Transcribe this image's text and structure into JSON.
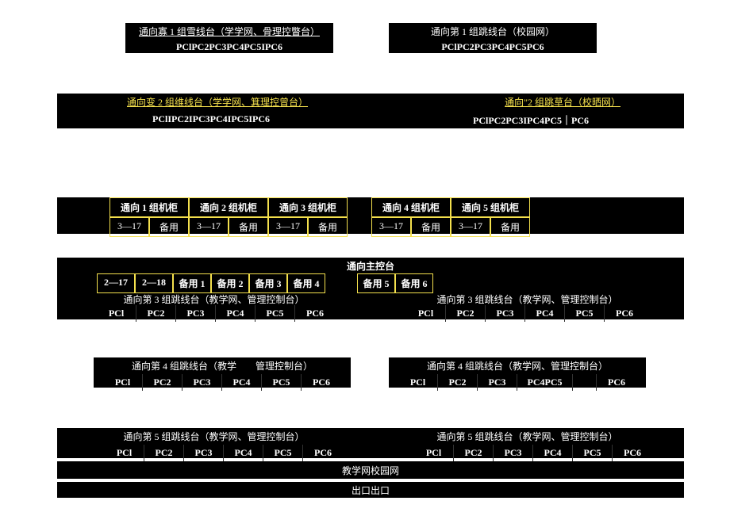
{
  "top_left": {
    "title": "通向寡 1 组雪线台（学学网、骨理控瞥台）",
    "pcs": "PClPC2PC3PC4PC5IPC6"
  },
  "top_right": {
    "title": "通向第 1 组跳线台（校园网）",
    "pcs": "PClPC2PC3PC4PC5PC6"
  },
  "row2_left": {
    "title": "通向变 2 组维线台（学学网、箕理控曾台）",
    "pcs": "PClIPC2IPC3PC4IPC5IPC6"
  },
  "row2_right": {
    "title": "通向\"2 组跳草台（校晒网）",
    "pcs": "PClPC2PC3IPC4PC5｜PC6"
  },
  "cab_row": {
    "cabs": [
      "通向 1 组机柜",
      "通向 2 组机柜",
      "通向 3 组机柜",
      "通向 4 组机柜",
      "通向 5 组机柜"
    ],
    "cells": [
      "3—17",
      "备用",
      "3—17",
      "备用",
      "3—17",
      "备用",
      "3—17",
      "备用",
      "3—17",
      "备用"
    ]
  },
  "main_console": {
    "title": "通向主控台",
    "cells": [
      "2—17",
      "2—18",
      "备用 1",
      "备用 2",
      "备用 3",
      "备用 4",
      "备用 5",
      "备用 6"
    ]
  },
  "row3": {
    "left_title": "通向第 3 组跳线台（教学网、管理控制台）",
    "right_title": "通向第 3 组跳线台（教学网、管理控制台）",
    "pcs": [
      "PCl",
      "PC2",
      "PC3",
      "PC4",
      "PC5",
      "PC6"
    ]
  },
  "row4": {
    "left_title": "通向第 4 组跳线台（教学　　管理控制台）",
    "right_title": "通向第 4 组跳线台（教学网、管理控制台）",
    "left_pcs": [
      "PCl",
      "PC2",
      "PC3",
      "PC4",
      "PC5",
      "PC6"
    ],
    "right_pcs": [
      "PCl",
      "PC2",
      "PC3",
      "PC4PC5",
      "",
      "PC6"
    ]
  },
  "row5": {
    "left_title": "通向第 5 组跳线台（教学网、管理控制台）",
    "right_title": "通向第 5 组跳线台（教学网、管理控制台）",
    "pcs": [
      "PCl",
      "PC2",
      "PC3",
      "PC4",
      "PC5",
      "PC6"
    ]
  },
  "footer1": "教学网校园网",
  "footer2": "出口出口"
}
